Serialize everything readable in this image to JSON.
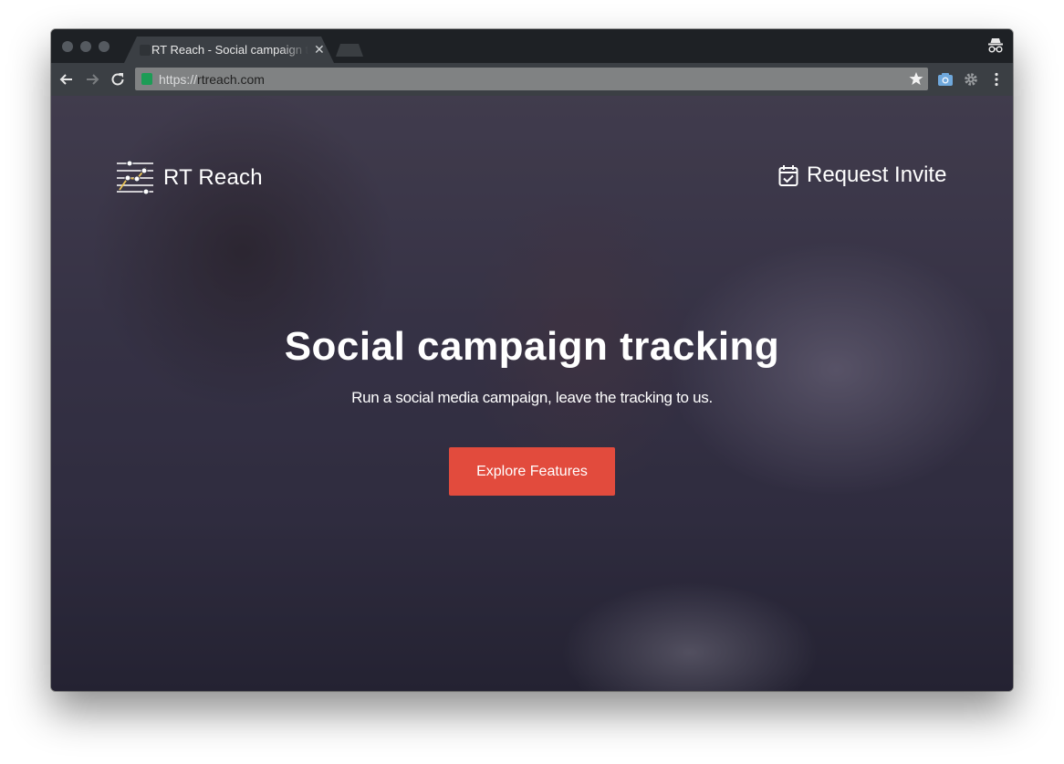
{
  "browser": {
    "tab_title": "RT Reach - Social campaign tracking",
    "tab_close": "✕",
    "url_scheme": "https://",
    "url_host": "rtreach.com"
  },
  "icons": {
    "back": "back-arrow-icon",
    "forward": "forward-arrow-icon",
    "reload": "reload-icon",
    "secure": "lock-icon",
    "bookmark": "star-icon",
    "camera": "camera-extension-icon",
    "settings": "gear-icon",
    "menu": "kebab-menu-icon",
    "incognito": "incognito-icon",
    "brand": "sliders-logo-icon",
    "invite": "calendar-check-icon"
  },
  "colors": {
    "accent": "#e24b3d",
    "secure": "#1d9c56",
    "logo_line": "#e7c257"
  },
  "site": {
    "brand_name": "RT Reach",
    "invite_label": "Request Invite",
    "hero_title": "Social campaign tracking",
    "hero_subtitle": "Run a social media campaign, leave the tracking to us.",
    "cta_label": "Explore Features"
  }
}
